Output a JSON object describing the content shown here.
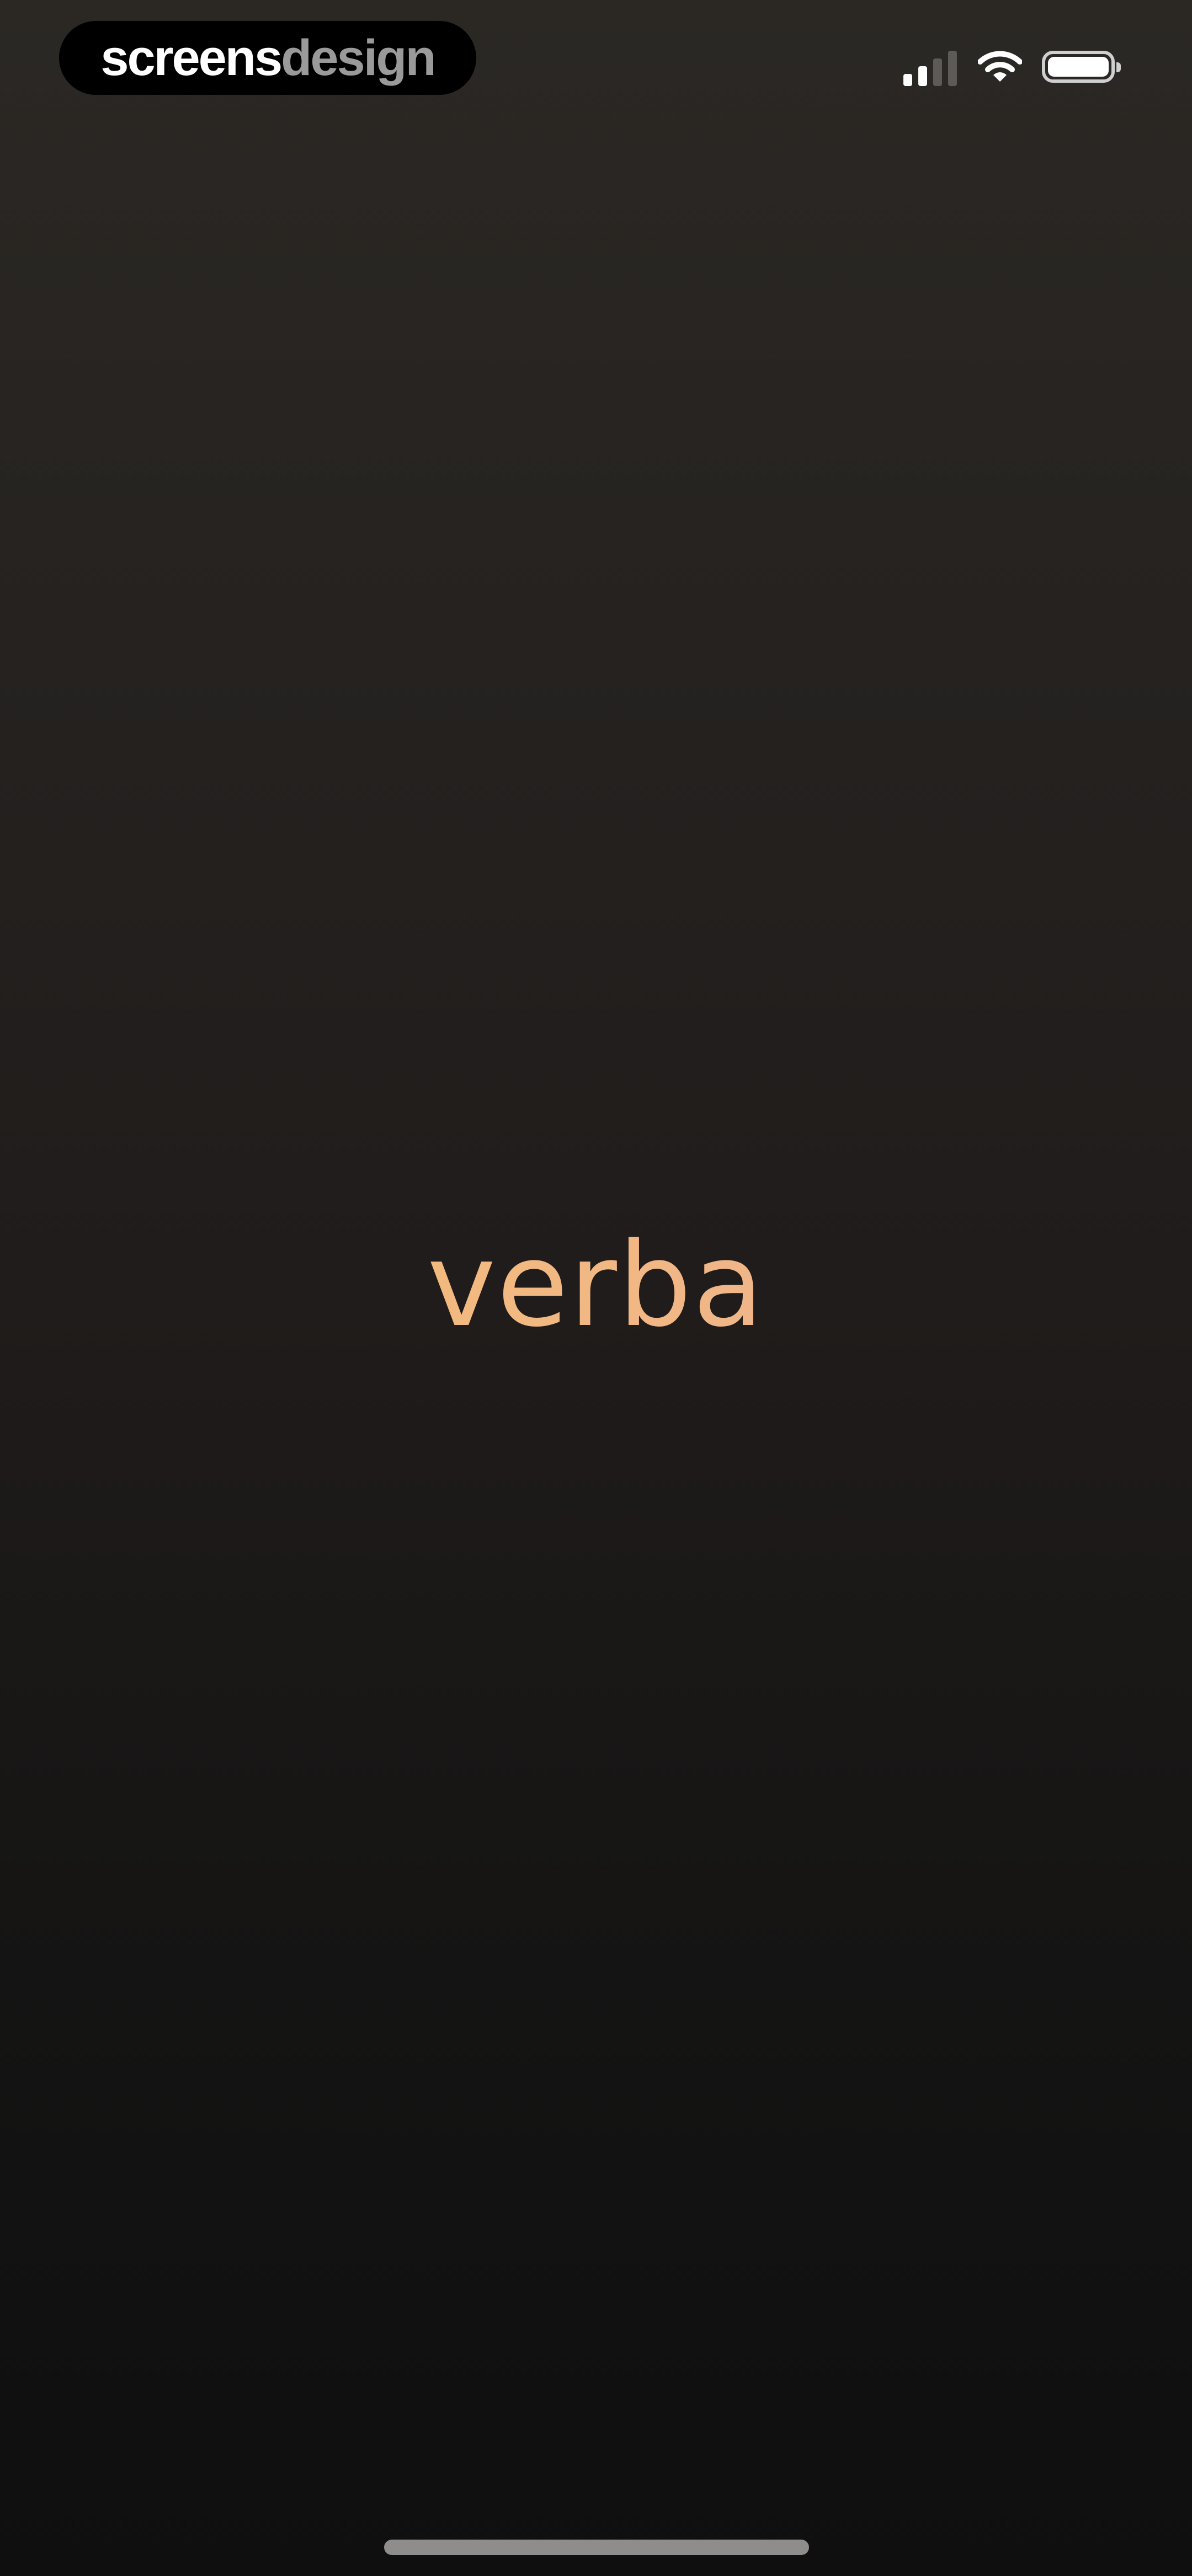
{
  "watermark": {
    "part1": "screens",
    "part2": "design"
  },
  "status_bar": {
    "signal_bars_active": 2,
    "signal_bars_total": 4,
    "wifi_icon": "wifi-icon",
    "battery_icon": "battery-icon",
    "battery_level": 1.0
  },
  "splash": {
    "logo_text": "verba"
  },
  "colors": {
    "logo_gradient_start": "#f4bd74",
    "logo_gradient_end": "#ecae96",
    "status_icon_active": "#ffffff",
    "status_icon_inactive": "#5d5a57",
    "home_indicator": "#8e8d8b"
  }
}
